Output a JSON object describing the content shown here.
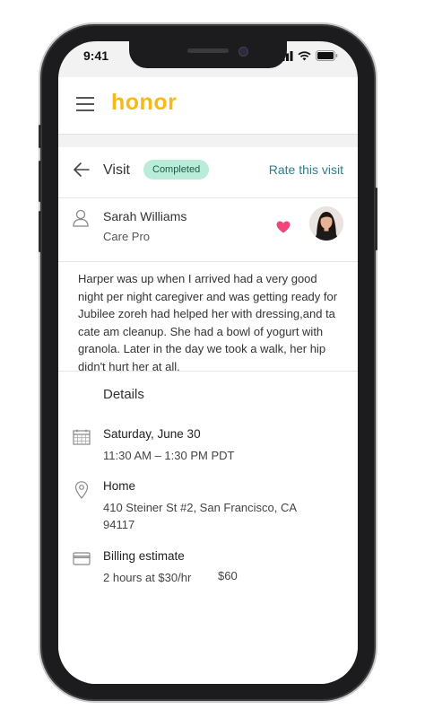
{
  "status_bar": {
    "time": "9:41"
  },
  "app": {
    "logo": "honor",
    "menu_icon": "hamburger-menu-icon"
  },
  "visit": {
    "title": "Visit",
    "status_badge": "Completed",
    "rate_link": "Rate this visit",
    "back_icon": "back-arrow-icon"
  },
  "care_pro": {
    "name": "Sarah Williams",
    "role": "Care Pro",
    "favorite_icon": "heart-icon",
    "person_icon": "person-icon"
  },
  "notes": "Harper was up when I arrived had a very good night per night caregiver and was getting ready for Jubilee zoreh had helped her with dressing,and ta cate am cleanup. She had a bowl of yogurt with granola. Later in the day we took a walk, her hip didn't hurt her at all.",
  "details": {
    "title": "Details",
    "date": {
      "label": "Saturday, June 30",
      "value": "11:30 AM – 1:30 PM PDT",
      "icon": "calendar-icon"
    },
    "location": {
      "label": "Home",
      "value": "410 Steiner St #2, San Francisco, CA 94117",
      "icon": "location-pin-icon"
    },
    "billing": {
      "label": "Billing estimate",
      "value": "2 hours at $30/hr",
      "amount": "$60",
      "icon": "credit-card-icon"
    }
  },
  "colors": {
    "brand": "#f7b918",
    "link": "#2d7f8c",
    "badge_bg": "#b9ecd9",
    "heart": "#f0457a"
  }
}
